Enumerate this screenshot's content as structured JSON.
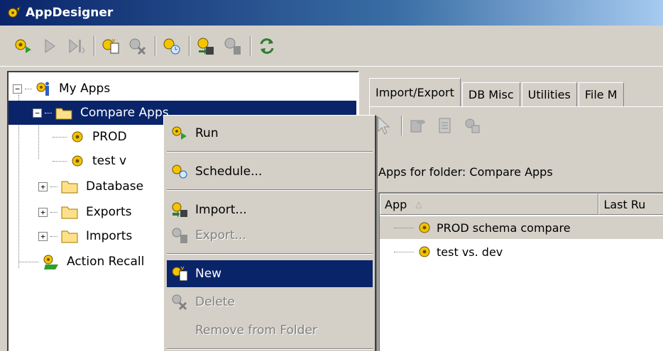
{
  "window": {
    "title": "AppDesigner"
  },
  "toolbar": {
    "buttons": [
      "run-app-icon",
      "play-icon",
      "step-icon",
      "new-app-icon",
      "delete-app-icon",
      "schedule-icon",
      "import-icon",
      "export-icon",
      "refresh-icon"
    ]
  },
  "tree": {
    "root": "My Apps",
    "compare_apps": "Compare Apps",
    "prod": "PROD",
    "test": "test v",
    "database": "Database",
    "exports": "Exports",
    "imports": "Imports",
    "action_recall": "Action Recall"
  },
  "context_menu": {
    "run": "Run",
    "schedule": "Schedule...",
    "import": "Import...",
    "export": "Export...",
    "new": "New",
    "delete": "Delete",
    "remove": "Remove from Folder"
  },
  "tabs": [
    "Import/Export",
    "DB Misc",
    "Utilities",
    "File M"
  ],
  "panel": {
    "folder_label": "Apps for folder: Compare Apps",
    "columns": [
      "App",
      "Last Ru"
    ],
    "rows": [
      "PROD schema compare",
      "test vs. dev"
    ]
  },
  "colors": {
    "selection": "#0a246a",
    "titlebar": "#0a246a",
    "face": "#d4d0c8"
  }
}
